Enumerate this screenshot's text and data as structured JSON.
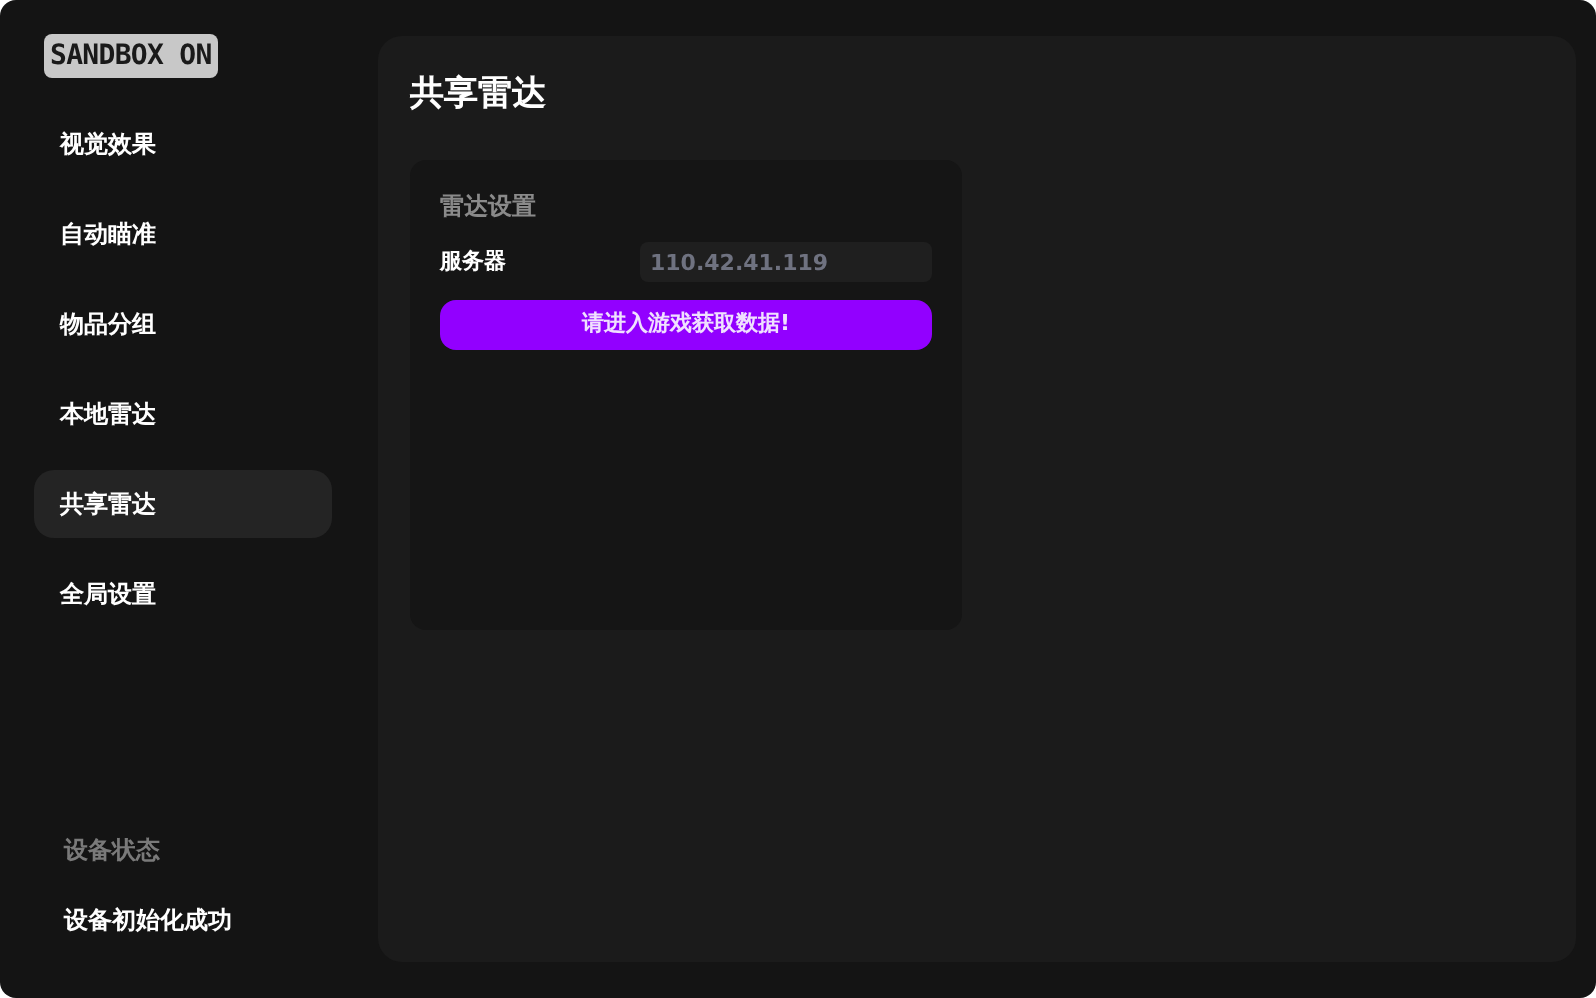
{
  "logo": "SANDBOX ON",
  "nav": [
    {
      "label": "视觉效果",
      "selected": false
    },
    {
      "label": "自动瞄准",
      "selected": false
    },
    {
      "label": "物品分组",
      "selected": false
    },
    {
      "label": "本地雷达",
      "selected": false
    },
    {
      "label": "共享雷达",
      "selected": true
    },
    {
      "label": "全局设置",
      "selected": false
    }
  ],
  "status": {
    "title": "设备状态",
    "message": "设备初始化成功"
  },
  "page_title": "共享雷达",
  "card": {
    "title": "雷达设置",
    "field_label": "服务器",
    "field_value": "110.42.41.119",
    "button": "请进入游戏获取数据!"
  }
}
